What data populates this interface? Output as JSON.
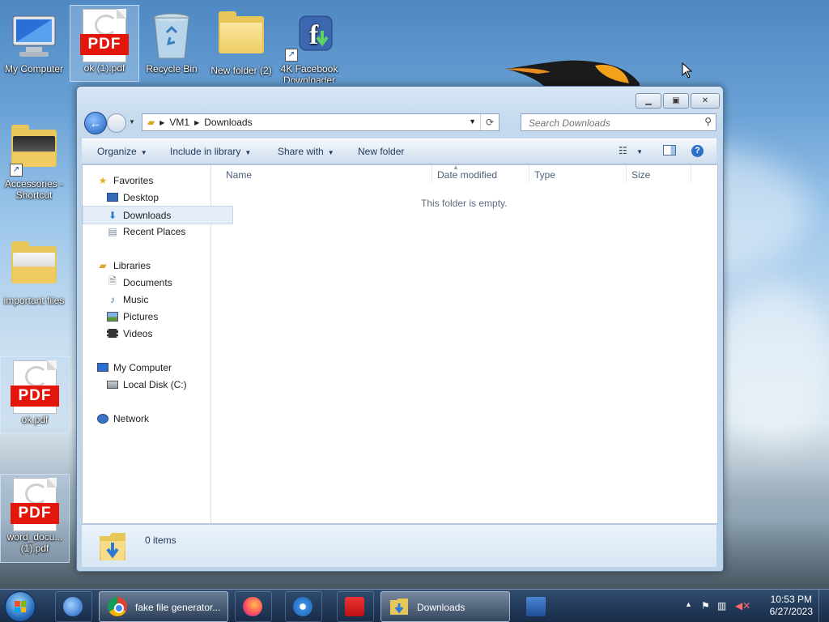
{
  "desktop": {
    "icons": [
      {
        "label": "My Computer"
      },
      {
        "label": "ok (1).pdf"
      },
      {
        "label": "Recycle Bin"
      },
      {
        "label": "New folder (2)"
      },
      {
        "label": "4K Facebook Downloader"
      },
      {
        "label": "Accessories - Shortcut"
      },
      {
        "label": "important files"
      },
      {
        "label": "ok.pdf"
      },
      {
        "label": "word_docu... (1).pdf"
      }
    ]
  },
  "window": {
    "address": {
      "segments": [
        "VM1",
        "Downloads"
      ]
    },
    "search": {
      "placeholder": "Search Downloads"
    },
    "toolbar": {
      "organize": "Organize",
      "include_in_library": "Include in library",
      "share_with": "Share with",
      "new_folder": "New folder"
    },
    "nav": {
      "favorites": "Favorites",
      "desktop": "Desktop",
      "downloads": "Downloads",
      "recent_places": "Recent Places",
      "libraries": "Libraries",
      "documents": "Documents",
      "music": "Music",
      "pictures": "Pictures",
      "videos": "Videos",
      "my_computer": "My Computer",
      "local_disk": "Local Disk (C:)",
      "network": "Network"
    },
    "columns": {
      "name": "Name",
      "date_modified": "Date modified",
      "type": "Type",
      "size": "Size"
    },
    "empty_message": "This folder is empty.",
    "details": {
      "item_count": "0 items"
    }
  },
  "taskbar": {
    "chrome_label": "fake file generator...",
    "explorer_label": "Downloads",
    "clock": {
      "time": "10:53 PM",
      "date": "6/27/2023"
    }
  },
  "colors": {
    "accent": "#1e395b",
    "selection": "#e5eef8"
  }
}
